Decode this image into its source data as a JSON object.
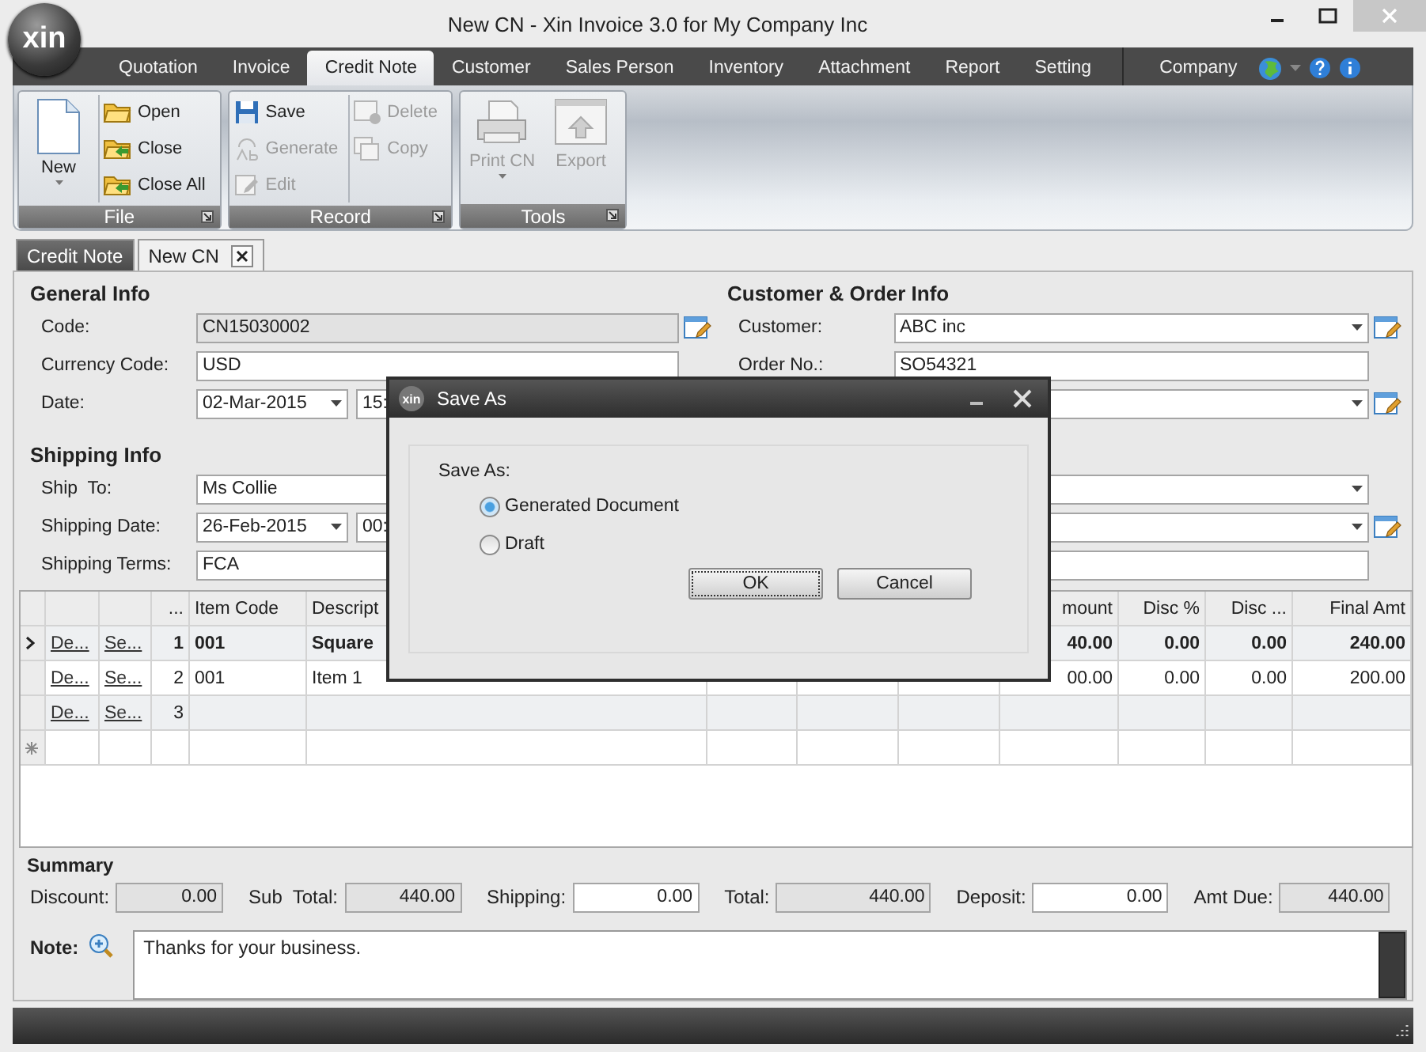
{
  "window": {
    "logo": "xin",
    "title": "New CN - Xin Invoice 3.0 for My Company Inc"
  },
  "menu": {
    "tabs": [
      {
        "label": "Quotation",
        "selected": false
      },
      {
        "label": "Invoice",
        "selected": false
      },
      {
        "label": "Credit Note",
        "selected": true
      },
      {
        "label": "Customer",
        "selected": false
      },
      {
        "label": "Sales Person",
        "selected": false
      },
      {
        "label": "Inventory",
        "selected": false
      },
      {
        "label": "Attachment",
        "selected": false
      },
      {
        "label": "Report",
        "selected": false
      },
      {
        "label": "Setting",
        "selected": false
      }
    ],
    "company": "Company"
  },
  "ribbon": {
    "groups": [
      {
        "title": "File",
        "columns": [
          [
            {
              "kind": "large",
              "label": "New",
              "disabled": false,
              "dropdown": true
            }
          ],
          [
            {
              "kind": "small",
              "label": "Open",
              "disabled": false
            },
            {
              "kind": "small",
              "label": "Close",
              "disabled": false
            },
            {
              "kind": "small",
              "label": "Close All",
              "disabled": false
            }
          ]
        ]
      },
      {
        "title": "Record",
        "columns": [
          [
            {
              "kind": "small",
              "label": "Save",
              "disabled": false
            },
            {
              "kind": "small",
              "label": "Generate",
              "disabled": true
            },
            {
              "kind": "small",
              "label": "Edit",
              "disabled": true
            }
          ],
          [
            {
              "kind": "small",
              "label": "Delete",
              "disabled": true
            },
            {
              "kind": "small",
              "label": "Copy",
              "disabled": true
            }
          ]
        ]
      },
      {
        "title": "Tools",
        "columns": [
          [
            {
              "kind": "large",
              "label": "Print CN",
              "disabled": true,
              "dropdown": true
            }
          ],
          [
            {
              "kind": "large",
              "label": "Export",
              "disabled": true,
              "dropdown": false
            }
          ]
        ]
      }
    ]
  },
  "doc_tabs": [
    {
      "label": "Credit Note",
      "selected": false,
      "closable": false
    },
    {
      "label": "New CN",
      "selected": true,
      "closable": true
    }
  ],
  "general": {
    "title": "General Info",
    "fields": [
      {
        "label": "Code:",
        "kind": "text",
        "value": "CN15030002",
        "readonly": true,
        "edit_button": true
      },
      {
        "label": "Currency Code:",
        "kind": "text",
        "value": "USD",
        "readonly": false,
        "edit_button": false
      },
      {
        "label": "Date:",
        "kind": "datetime",
        "value": "02-Mar-2015",
        "time": "15:",
        "readonly": false
      }
    ]
  },
  "customer": {
    "title": "Customer & Order Info",
    "fields": [
      {
        "label": "Customer:",
        "kind": "combo",
        "value": "ABC inc",
        "readonly": false,
        "edit_button": true
      },
      {
        "label": "Order No.:",
        "kind": "text",
        "value": "SO54321",
        "readonly": false,
        "edit_button": false
      },
      {
        "kind": "combo",
        "readonly": false,
        "edit_button": true
      }
    ]
  },
  "shipping": {
    "title": "Shipping Info",
    "fields": [
      {
        "label": "Ship  To:",
        "kind": "combo",
        "value": "Ms Collie",
        "readonly": false,
        "edit_button": false
      },
      {
        "label": "Shipping Date:",
        "kind": "datetime",
        "value": "26-Feb-2015",
        "time": "00:",
        "readonly": false,
        "edit_button": true
      },
      {
        "label": "Shipping Terms:",
        "kind": "text",
        "value": "FCA",
        "readonly": false,
        "edit_button": false
      }
    ]
  },
  "grid": {
    "columns": [
      "...",
      "Item Code",
      "Descript",
      "mount",
      "Disc %",
      "Disc ...",
      "Final Amt"
    ],
    "rows": [
      {
        "current": true,
        "new": false,
        "delete_link": "De...",
        "select_link": "Se...",
        "no": "1",
        "item_code": "001",
        "description": "Square",
        "amount": "40.00",
        "disc_pct": "0.00",
        "disc_amt": "0.00",
        "final_amt": "240.00"
      },
      {
        "current": false,
        "new": false,
        "delete_link": "De...",
        "select_link": "Se...",
        "no": "2",
        "item_code": "001",
        "description": "Item 1",
        "amount": "00.00",
        "disc_pct": "0.00",
        "disc_amt": "0.00",
        "final_amt": "200.00"
      },
      {
        "current": false,
        "new": false,
        "delete_link": "De...",
        "select_link": "Se...",
        "no": "3"
      },
      {
        "current": false,
        "new": true
      }
    ]
  },
  "summary": {
    "title": "Summary",
    "fields": [
      {
        "label": "Discount:",
        "value": "0.00",
        "readonly": true
      },
      {
        "label": "Sub  Total:",
        "value": "440.00",
        "readonly": true
      },
      {
        "label": "Shipping:",
        "value": "0.00",
        "readonly": false
      },
      {
        "label": "Total:",
        "value": "440.00",
        "readonly": true
      },
      {
        "label": "Deposit:",
        "value": "0.00",
        "readonly": false
      },
      {
        "label": "Amt Due:",
        "value": "440.00",
        "readonly": true
      }
    ]
  },
  "note": {
    "label": "Note:",
    "value": "Thanks for your business."
  },
  "dialog": {
    "logo": "xin",
    "title": "Save As",
    "prompt": "Save As:",
    "options": [
      {
        "label": "Generated Document",
        "selected": true
      },
      {
        "label": "Draft",
        "selected": false
      }
    ],
    "buttons": [
      {
        "label": "OK",
        "focused": true
      },
      {
        "label": "Cancel",
        "focused": false
      }
    ]
  }
}
